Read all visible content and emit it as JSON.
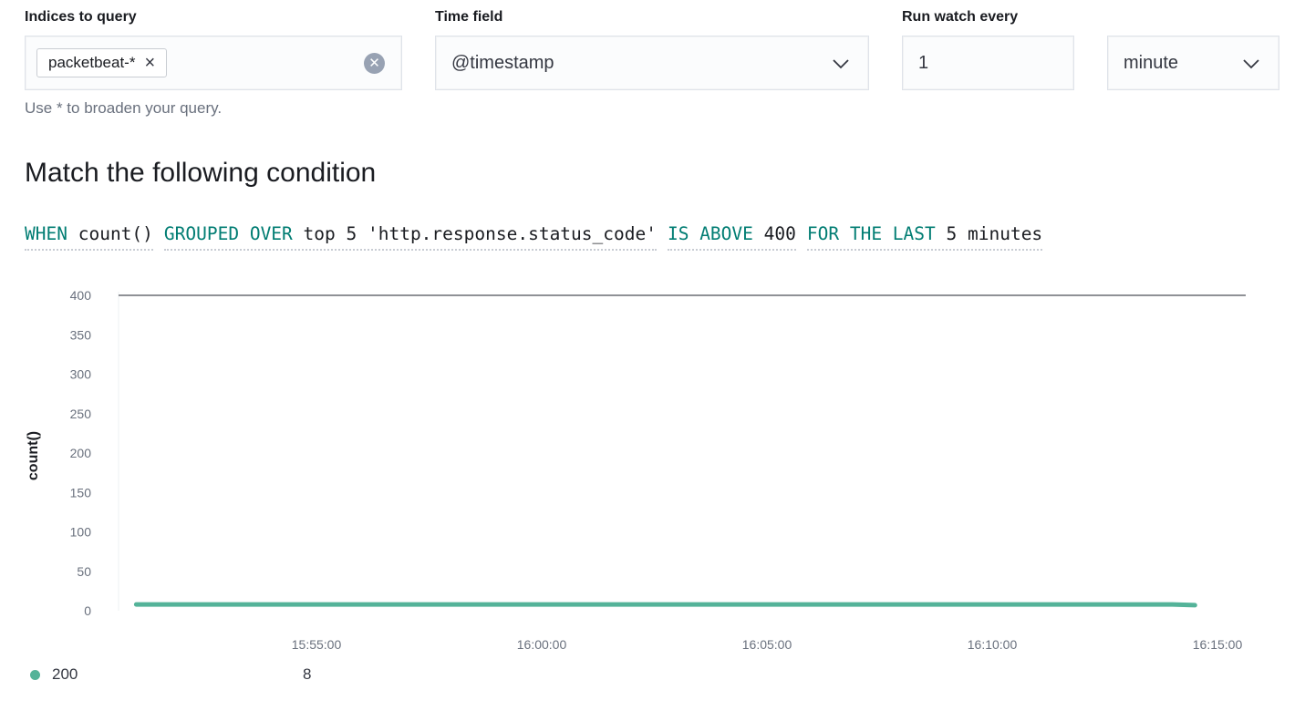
{
  "indices": {
    "label": "Indices to query",
    "chip": "packetbeat-*",
    "chip_remove_icon": "cross-icon",
    "clear_icon": "clear-circle-icon",
    "help": "Use * to broaden your query."
  },
  "time_field": {
    "label": "Time field",
    "value": "@timestamp",
    "icon": "chevron-down-icon"
  },
  "run_watch": {
    "label": "Run watch every",
    "value": "1",
    "unit": "minute",
    "icon": "chevron-down-icon"
  },
  "condition": {
    "title": "Match the following condition",
    "when_kw": "WHEN",
    "when_val": "count()",
    "grouped_kw": "GROUPED OVER",
    "grouped_val": "top 5 'http.response.status_code'",
    "threshold_kw": "IS ABOVE",
    "threshold_val": "400",
    "window_kw": "FOR THE LAST",
    "window_val": "5 minutes"
  },
  "colors": {
    "series": "#54b399",
    "keyword": "#017d73",
    "threshold_line": "#6a6d73"
  },
  "chart_data": {
    "type": "line",
    "ylabel": "count()",
    "ylim": [
      0,
      400
    ],
    "yticks": [
      "400",
      "350",
      "300",
      "250",
      "200",
      "150",
      "100",
      "50",
      "0"
    ],
    "xticks": [
      "15:55:00",
      "16:00:00",
      "16:05:00",
      "16:10:00",
      "16:15:00"
    ],
    "threshold": 400,
    "series": [
      {
        "name": "200",
        "x": [
          "15:51:00",
          "16:14:00",
          "16:14:30"
        ],
        "values": [
          8,
          8,
          7
        ]
      }
    ],
    "legend": [
      {
        "name": "200",
        "value": "8"
      }
    ]
  }
}
